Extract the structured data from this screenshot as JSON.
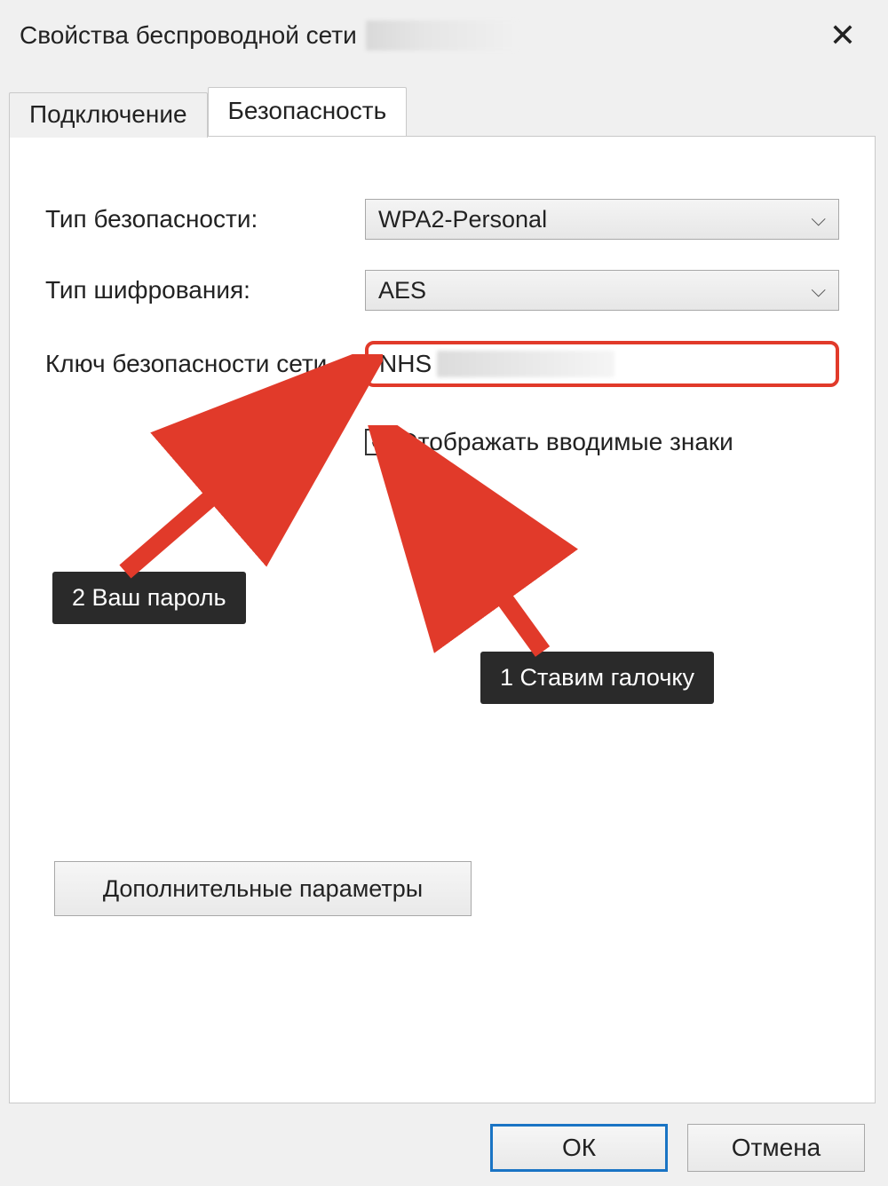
{
  "window": {
    "title": "Свойства беспроводной сети"
  },
  "tabs": {
    "connection_label": "Подключение",
    "security_label": "Безопасность"
  },
  "form": {
    "security_type_label": "Тип безопасности:",
    "security_type_value": "WPA2-Personal",
    "encryption_label": "Тип шифрования:",
    "encryption_value": "AES",
    "key_label": "Ключ безопасности сети",
    "key_value": "NHS",
    "show_chars_label": "Отображать вводимые знаки",
    "show_chars_checked": true,
    "advanced_button": "Дополнительные параметры"
  },
  "buttons": {
    "ok": "ОК",
    "cancel": "Отмена"
  },
  "annotations": {
    "step1": "1 Ставим галочку",
    "step2": "2 Ваш пароль"
  },
  "colors": {
    "highlight_red": "#e13a2a",
    "primary_blue": "#1a74c4",
    "callout_bg": "#2a2a2a"
  }
}
